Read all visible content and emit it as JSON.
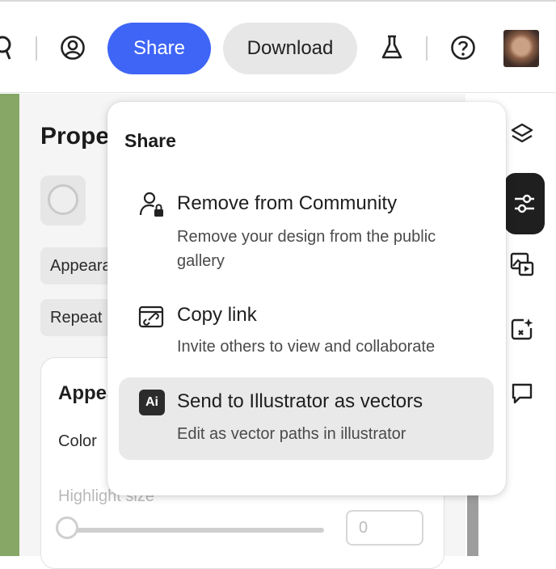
{
  "header": {
    "share_label": "Share",
    "download_label": "Download",
    "icons": [
      "cut-off-icon",
      "account-icon",
      "labs-flask-icon",
      "help-icon"
    ]
  },
  "properties": {
    "title": "Proper",
    "chips": [
      "Appeara",
      "Repeat"
    ],
    "card": {
      "title": "Appea",
      "color_label": "Color",
      "highlight_label": "Highlight size",
      "highlight_value": "0"
    }
  },
  "share_menu": {
    "title": "Share",
    "items": [
      {
        "icon": "user-lock-icon",
        "title": "Remove from Community",
        "description": "Remove your design from the public gallery"
      },
      {
        "icon": "copy-link-icon",
        "title": "Copy link",
        "description": "Invite others to view and collaborate"
      },
      {
        "icon": "illustrator-icon",
        "icon_text": "Ai",
        "title": "Send to Illustrator as vectors",
        "description": "Edit as vector paths in illustrator",
        "selected": true
      }
    ]
  },
  "rail": {
    "items": [
      "layers-icon",
      "adjustments-icon",
      "media-icon",
      "generate-icon",
      "comment-icon"
    ],
    "active": "adjustments-icon"
  },
  "colors": {
    "accent": "#3f65f6",
    "canvas_green": "#86a766"
  }
}
